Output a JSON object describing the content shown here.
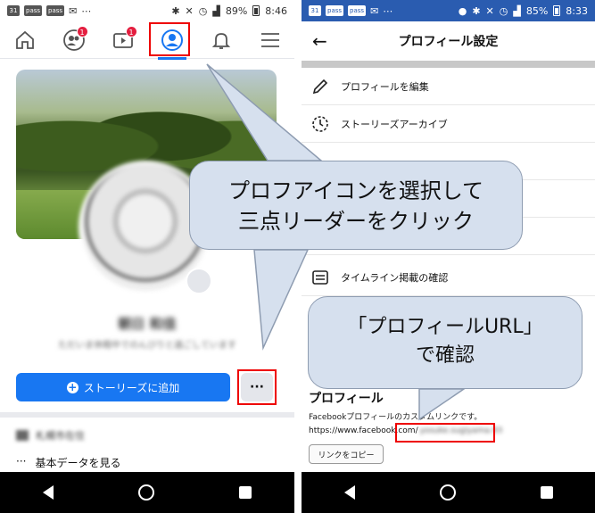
{
  "left": {
    "status": {
      "chips": [
        "31",
        "pass",
        "pass"
      ],
      "battery": "89%",
      "time": "8:46"
    },
    "nav": {
      "badges": {
        "friends": "1",
        "watch": "1"
      }
    },
    "profile": {
      "name": "朝日 和佳",
      "bio": "ただいま休暇中でのんびりと過ごしています"
    },
    "story_button": "ストーリーズに追加",
    "more_button": "···",
    "blur_row": "札幌市在住",
    "basic_row": {
      "dots": "···",
      "label": "基本データを見る"
    }
  },
  "right": {
    "status": {
      "chips": [
        "31",
        "pass",
        "pass"
      ],
      "battery": "85%",
      "time": "8:33"
    },
    "header": {
      "back": "←",
      "title": "プロフィール設定"
    },
    "menu": [
      {
        "label": "プロフィールを編集"
      },
      {
        "label": "ストーリーズアーカイブ"
      },
      {
        "label": "タイムライン掲載の確認"
      }
    ],
    "profile_link": {
      "title": "プロフィール",
      "subtitle": "Facebookプロフィールのカスタムリンクです。",
      "url_prefix": "https://www.facebook.com/",
      "url_blur": "yosuke.sugiyama.93",
      "copy_button": "リンクをコピー"
    }
  },
  "callouts": {
    "c1": {
      "line1": "プロフアイコンを選択して",
      "line2": "三点リーダーをクリック"
    },
    "c2": {
      "line1": "「プロフィールURL」",
      "line2": "で確認"
    }
  },
  "colors": {
    "fb_blue": "#1877f2",
    "status_blue": "#2a5cb0",
    "highlight_red": "#e00000",
    "callout_fill": "#d6e0ee"
  }
}
